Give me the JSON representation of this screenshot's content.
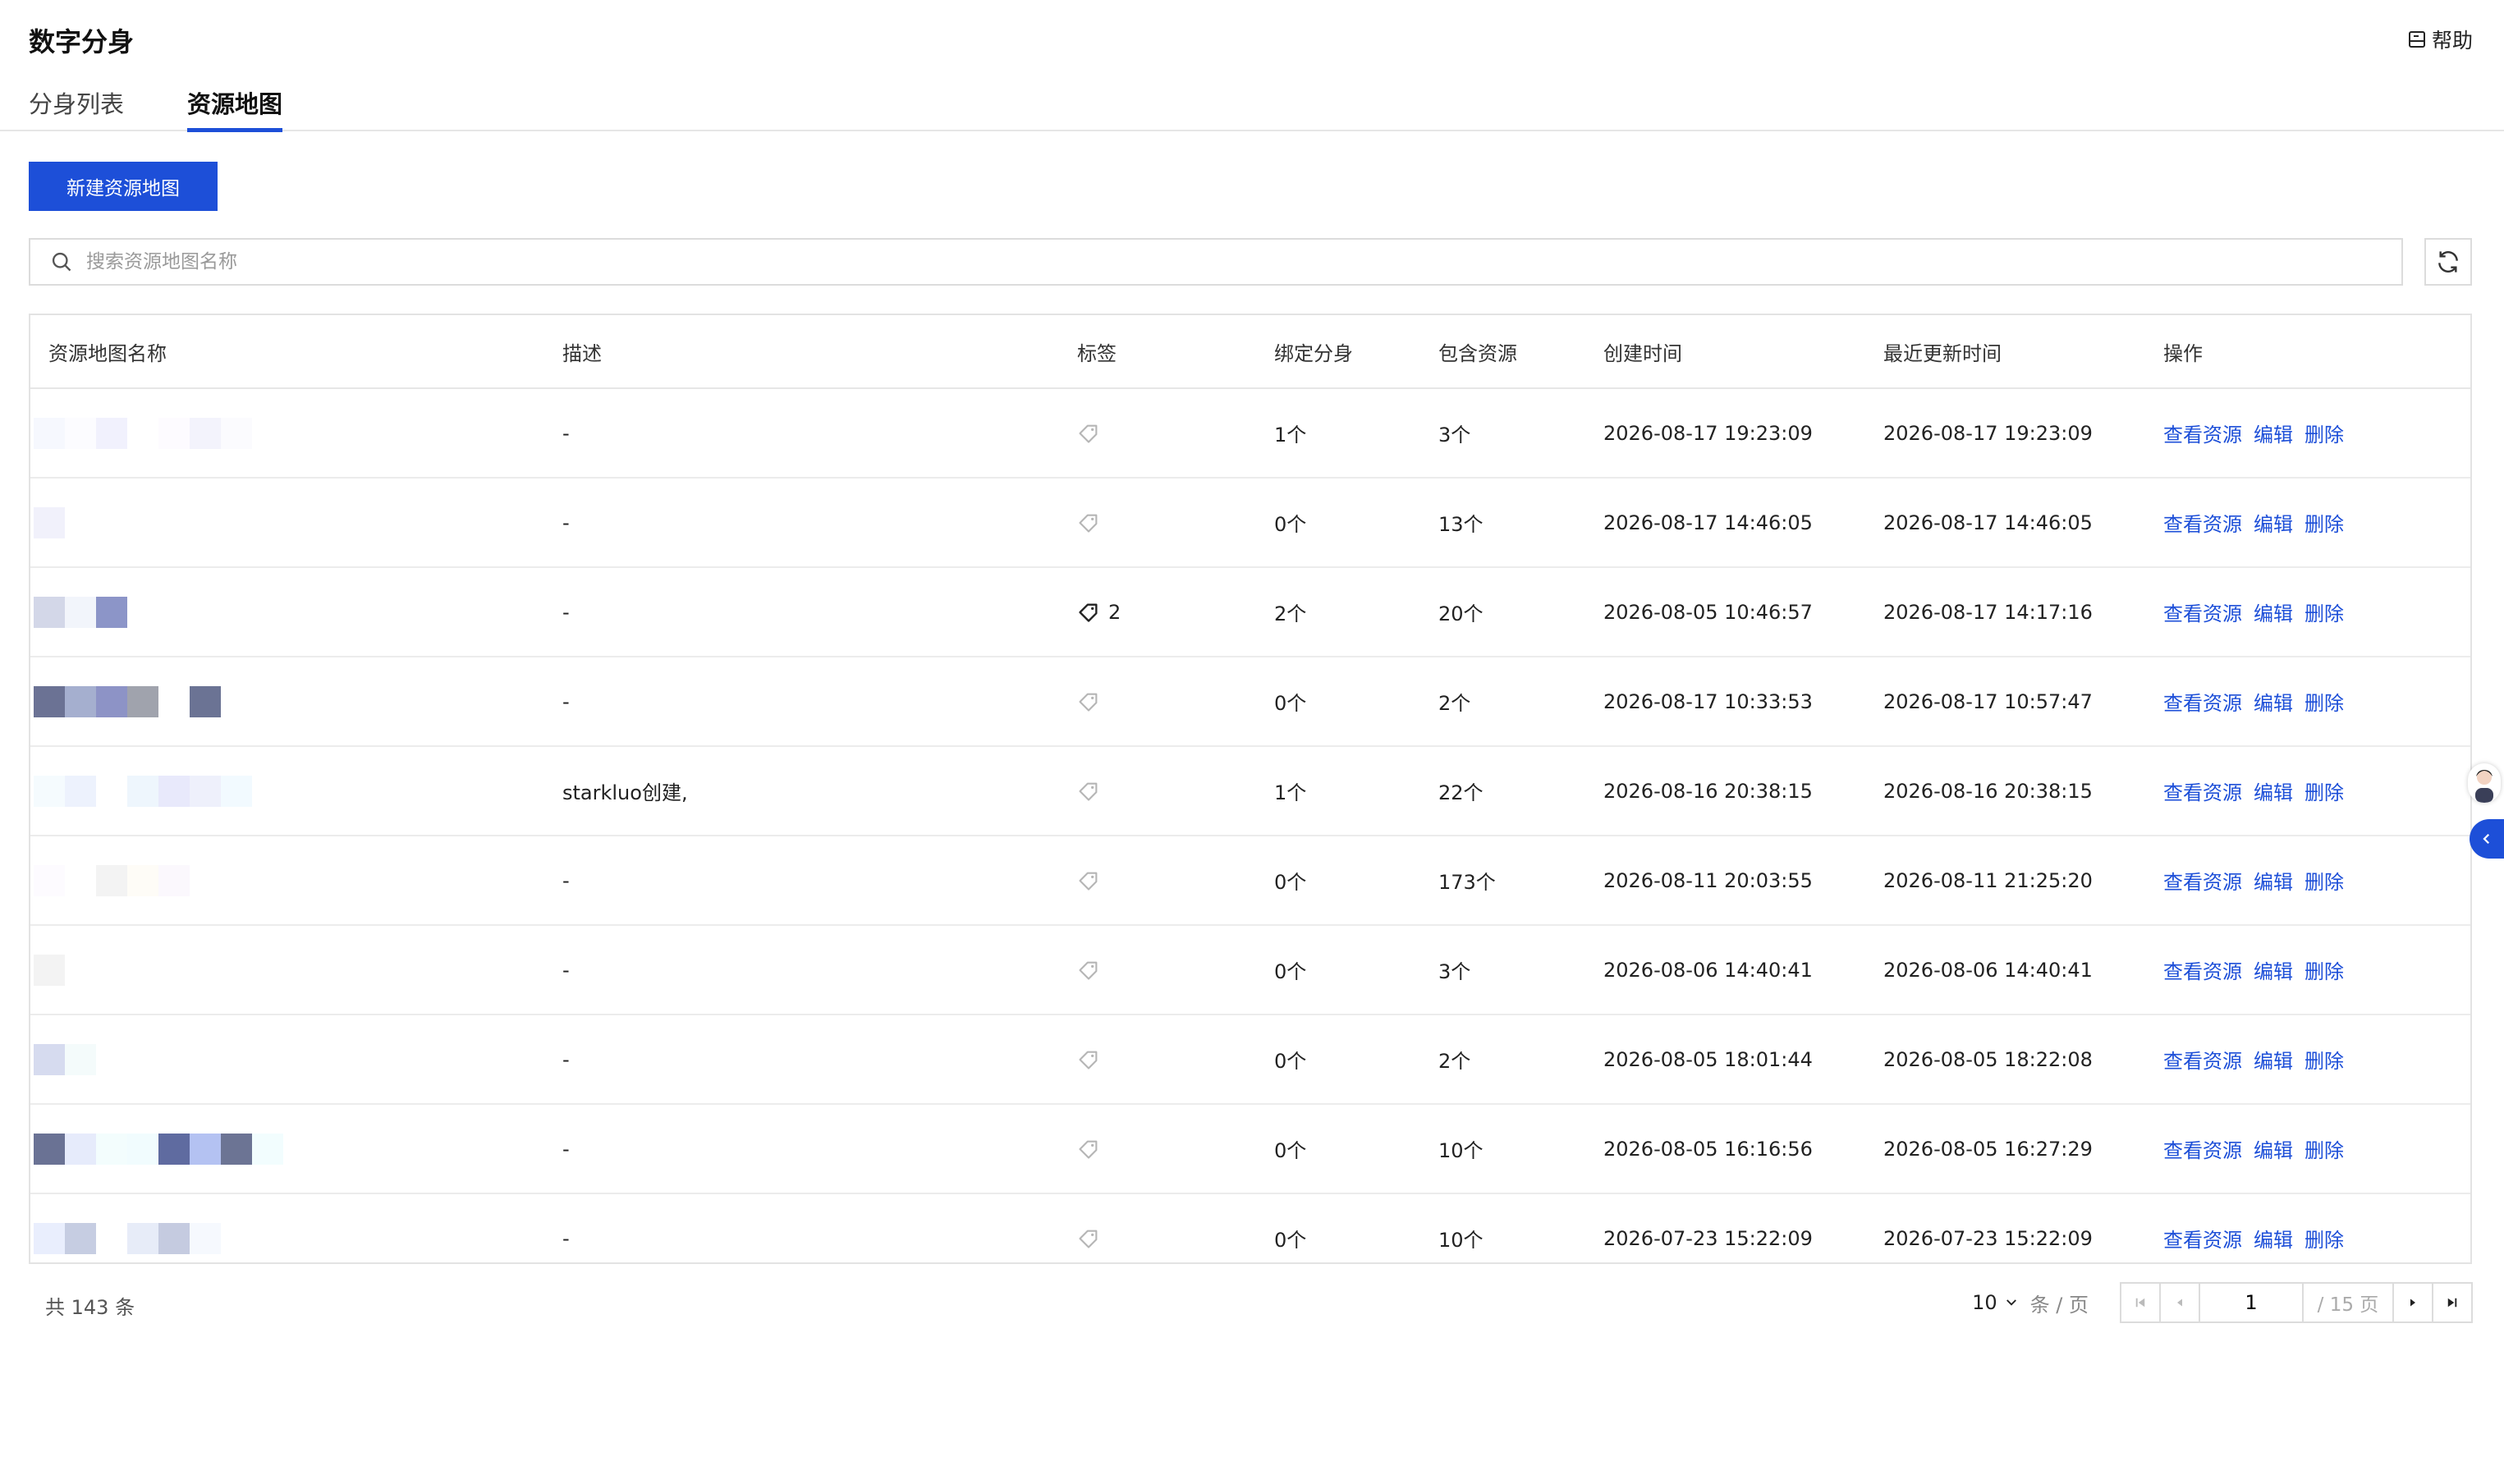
{
  "app": {
    "title": "数字分身",
    "help_label": "帮助"
  },
  "tabs": [
    {
      "label": "分身列表",
      "active": false
    },
    {
      "label": "资源地图",
      "active": true
    }
  ],
  "toolbar": {
    "new_button_label": "新建资源地图"
  },
  "search": {
    "placeholder": "搜索资源地图名称",
    "value": ""
  },
  "table": {
    "columns": [
      "资源地图名称",
      "描述",
      "标签",
      "绑定分身",
      "包含资源",
      "创建时间",
      "最近更新时间",
      "操作"
    ],
    "actions": [
      "查看资源",
      "编辑",
      "删除"
    ],
    "rows": [
      {
        "description": "-",
        "tag_count": "",
        "bound": "1个",
        "resources": "3个",
        "created": "2026-08-17 19:23:09",
        "updated": "2026-08-17 19:23:09",
        "name_colors": [
          "#f6f8fe",
          "#fcfcff",
          "#f1f1fd",
          "#ffffff",
          "#fdfbff",
          "#f3f3fc",
          "#fbfbfe"
        ]
      },
      {
        "description": "-",
        "tag_count": "",
        "bound": "0个",
        "resources": "13个",
        "created": "2026-08-17 14:46:05",
        "updated": "2026-08-17 14:46:05",
        "name_colors": [
          "#f1f1fb"
        ]
      },
      {
        "description": "-",
        "tag_count": "2",
        "bound": "2个",
        "resources": "20个",
        "created": "2026-08-05 10:46:57",
        "updated": "2026-08-17 14:17:16",
        "name_colors": [
          "#d3d7e8",
          "#f2f5fb",
          "#8c95c8"
        ]
      },
      {
        "description": "-",
        "tag_count": "",
        "bound": "0个",
        "resources": "2个",
        "created": "2026-08-17 10:33:53",
        "updated": "2026-08-17 10:57:47",
        "name_colors": [
          "#6b7294",
          "#a5afcf",
          "#8d93c6",
          "#a0a3ad",
          "#ffffff",
          "#6b7394"
        ]
      },
      {
        "description": "starkluo创建,",
        "tag_count": "",
        "bound": "1个",
        "resources": "22个",
        "created": "2026-08-16 20:38:15",
        "updated": "2026-08-16 20:38:15",
        "name_colors": [
          "#f5fbfe",
          "#edf2fd",
          "#ffffff",
          "#eef6fd",
          "#e8e9fb",
          "#eef0fb",
          "#f2faff"
        ]
      },
      {
        "description": "-",
        "tag_count": "",
        "bound": "0个",
        "resources": "173个",
        "created": "2026-08-11 20:03:55",
        "updated": "2026-08-11 21:25:20",
        "name_colors": [
          "#fdfbff",
          "#ffffff",
          "#f3f3f3",
          "#fefcf7",
          "#fbf8fd"
        ]
      },
      {
        "description": "-",
        "tag_count": "",
        "bound": "0个",
        "resources": "3个",
        "created": "2026-08-06 14:40:41",
        "updated": "2026-08-06 14:40:41",
        "name_colors": [
          "#f3f3f3"
        ]
      },
      {
        "description": "-",
        "tag_count": "",
        "bound": "0个",
        "resources": "2个",
        "created": "2026-08-05 18:01:44",
        "updated": "2026-08-05 18:22:08",
        "name_colors": [
          "#d6dbef",
          "#f4fbfb"
        ]
      },
      {
        "description": "-",
        "tag_count": "",
        "bound": "0个",
        "resources": "10个",
        "created": "2026-08-05 16:16:56",
        "updated": "2026-08-05 16:27:29",
        "name_colors": [
          "#6a7294",
          "#e6ebfb",
          "#f3fdfd",
          "#f1fcfe",
          "#5f6ba0",
          "#b4c2f2",
          "#6c7494",
          "#f2fdfe"
        ]
      },
      {
        "description": "-",
        "tag_count": "",
        "bound": "0个",
        "resources": "10个",
        "created": "2026-07-23 15:22:09",
        "updated": "2026-07-23 15:22:09",
        "name_colors": [
          "#e9eefd",
          "#c6cde2",
          "#ffffff",
          "#e7ecf8",
          "#c5cbe0",
          "#f6f9fe"
        ]
      }
    ]
  },
  "pagination": {
    "total_text": "共 143 条",
    "page_size": "10",
    "per_page_label": "条 / 页",
    "current_page": "1",
    "total_pages_text": "/ 15 页"
  },
  "colors": {
    "accent": "#1d4fd8",
    "border": "#dcdcdc",
    "text": "#222222",
    "muted": "#9a9a9a"
  },
  "icons": [
    "help-icon",
    "search-icon",
    "refresh-icon",
    "tag-icon",
    "first-page-icon",
    "prev-page-icon",
    "next-page-icon",
    "last-page-icon",
    "chevron-down-icon",
    "chevron-left-icon",
    "avatar"
  ]
}
